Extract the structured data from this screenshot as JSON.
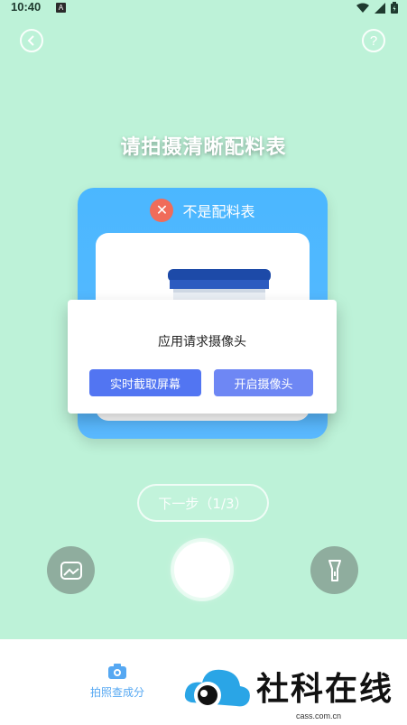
{
  "status_bar": {
    "time": "10:40",
    "notif_letter": "A"
  },
  "header": {
    "back_icon": "chevron-left-icon",
    "help_icon": "question-icon",
    "help_glyph": "?"
  },
  "title": "请拍摄清晰配料表",
  "card": {
    "status_label": "不是配料表",
    "status_icon": "close-icon",
    "status_glyph": "✕",
    "status_color": "#f06c5a"
  },
  "dialog": {
    "title": "应用请求摄像头",
    "btn_screen": "实时截取屏幕",
    "btn_camera": "开启摄像头",
    "btn_screen_color": "#5275f2",
    "btn_camera_color": "#6e87f4"
  },
  "next_button": "下一步（1/3）",
  "controls": {
    "gallery_icon": "gallery-icon",
    "shutter": "shutter-button",
    "torch_icon": "flashlight-icon"
  },
  "bottom_tab": {
    "label": "拍照查成分",
    "icon": "camera-icon",
    "color": "#56a8f2"
  },
  "watermark": {
    "text": "社科在线",
    "domain": "cass.com.cn"
  }
}
